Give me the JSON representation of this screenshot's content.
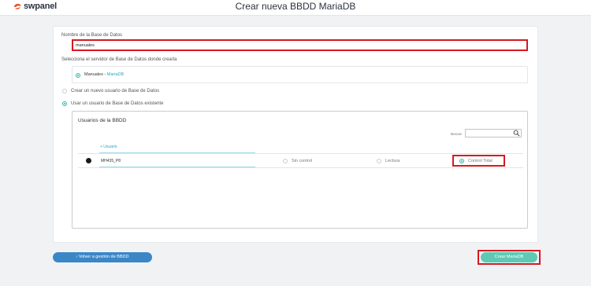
{
  "header": {
    "logo_text": "swpanel",
    "title": "Crear nueva BBDD MariaDB"
  },
  "form": {
    "db_name_label": "Nombre de la Base de Datos",
    "db_name_value": "manuales",
    "server_label": "Selecciona el servidor de Base de Datos donde crearla",
    "server": {
      "name": "Manuales",
      "separator": " - ",
      "version": "MariaDB",
      "selected": true
    },
    "options": {
      "new_user_label": "Crear un nuevo usuario de Base de Datos",
      "existing_user_label": "Usar un usuario de Base de Datos existente",
      "existing_selected": true
    },
    "users": {
      "title": "Usuarios de la BBDD",
      "search_label": "Buscar",
      "search_placeholder": "",
      "add_user_label": "+ Usuario",
      "rows": [
        {
          "name": "MH435_P8",
          "permissions": {
            "none": "Sin control",
            "read": "Lectura",
            "full": "Control Total",
            "selected": "full"
          }
        }
      ]
    }
  },
  "footer": {
    "back_label": "‹ Volver a gestión de BBDD",
    "create_label": "Crear MariaDB"
  },
  "colors": {
    "accent_teal": "#2bb5a0",
    "button_blue": "#3a87c8",
    "highlight_red": "#d71920",
    "create_button": "#5fc9b4"
  }
}
